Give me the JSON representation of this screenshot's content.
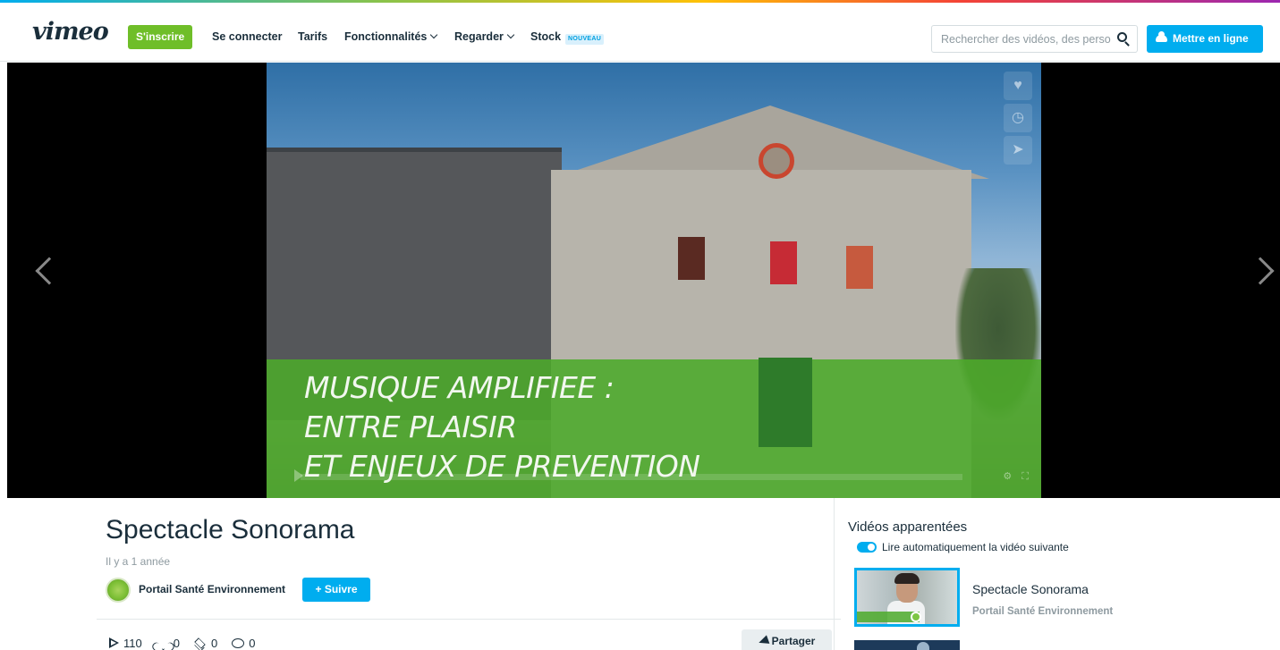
{
  "header": {
    "logo": "vimeo",
    "join_label": "S'inscrire",
    "login_label": "Se connecter",
    "pricing_label": "Tarifs",
    "features_label": "Fonctionnalités",
    "watch_label": "Regarder",
    "stock_label": "Stock",
    "stock_badge": "NOUVEAU",
    "search_placeholder": "Rechercher des vidéos, des personnes...",
    "upload_label": "Mettre en ligne"
  },
  "video": {
    "title_lines": [
      "MUSIQUE AMPLIFIEE :",
      "ENTRE PLAISIR",
      "ET ENJEUX DE PREVENTION"
    ],
    "side_controls": [
      "heart-icon",
      "clock-icon",
      "share-icon"
    ]
  },
  "clip": {
    "title": "Spectacle Sonorama",
    "date": "Il y a 1 année",
    "channel": "Portail Santé Environnement",
    "follow_label": "+ Suivre",
    "stats": {
      "plays": "110",
      "likes": "0",
      "collections": "0",
      "comments": "0"
    },
    "share_label": "Partager"
  },
  "related": {
    "heading": "Vidéos apparentées",
    "autoplay_label": "Lire automatiquement la vidéo suivante",
    "autoplay_on": true,
    "items": [
      {
        "title": "Spectacle Sonorama",
        "author": "Portail Santé Environnement"
      }
    ]
  },
  "colors": {
    "accent_blue": "#00adef",
    "join_green": "#6fbe29",
    "text_dark": "#1a2e3b",
    "text_muted": "#8e9aa0"
  }
}
